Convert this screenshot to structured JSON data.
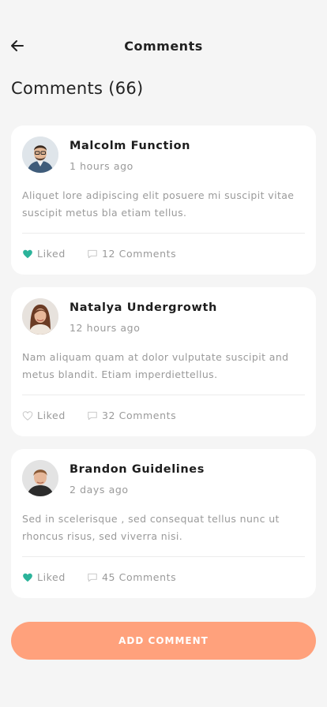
{
  "header": {
    "title": "Comments",
    "back_icon": "arrow-left-icon"
  },
  "section": {
    "heading": "Comments (66)"
  },
  "colors": {
    "accent": "#ffa17c",
    "liked": "#2bb39a",
    "muted": "#9a9a9a",
    "background": "#f5f5f5"
  },
  "comments": [
    {
      "author": "Malcolm Function",
      "time": "1 hours ago",
      "text": "Aliquet lore adipiscing elit posuere mi suscipit vitae suscipit metus bla etiam tellus.",
      "liked": true,
      "like_label": "Liked",
      "comments_label": "12 Comments"
    },
    {
      "author": "Natalya Undergrowth",
      "time": "12 hours ago",
      "text": "Nam aliquam quam at dolor vulputate suscipit and metus blandit. Etiam imperdiettellus.",
      "liked": false,
      "like_label": "Liked",
      "comments_label": "32 Comments"
    },
    {
      "author": "Brandon Guidelines",
      "time": "2 days ago",
      "text": "Sed in scelerisque , sed consequat tellus nunc ut rhoncus risus, sed viverra nisi.",
      "liked": true,
      "like_label": "Liked",
      "comments_label": "45 Comments"
    }
  ],
  "footer": {
    "add_button_label": "ADD COMMENT"
  }
}
